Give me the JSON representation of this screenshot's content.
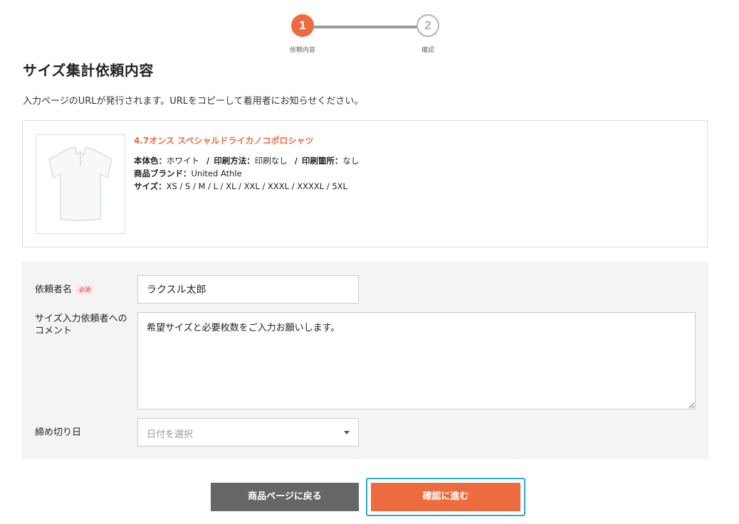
{
  "stepper": {
    "steps": [
      {
        "number": "1",
        "label": "依頼内容"
      },
      {
        "number": "2",
        "label": "確認"
      }
    ],
    "colors": {
      "active": "#ed6c3f",
      "inactive": "#b3b3b3",
      "line": "#9a9a9a"
    }
  },
  "page": {
    "title": "サイズ集計依頼内容",
    "intro": "入力ページのURLが発行されます。URLをコピーして着用者にお知らせください。"
  },
  "product": {
    "image_icon": "polo-shirt-icon",
    "name": "4.7オンス スペシャルドライカノコポロシャツ",
    "body_color_label": "本体色：",
    "body_color_value": "ホワイト",
    "sep1": "/",
    "print_method_label": "印刷方法：",
    "print_method_value": "印刷なし",
    "sep2": "/",
    "print_location_label": "印刷箇所：",
    "print_location_value": "なし",
    "brand_label": "商品ブランド：",
    "brand_value": "United Athle",
    "size_label": "サイズ：",
    "size_value": "XS / S / M / L / XL / XXL / XXXL / XXXXL / 5XL"
  },
  "form": {
    "requester_label": "依頼者名",
    "required_badge": "必須",
    "requester_value": "ラクスル太郎",
    "comment_label_line1": "サイズ入力依頼者への",
    "comment_label_line2": "コメント",
    "comment_value": "希望サイズと必要枚数をご入力お願いします。",
    "deadline_label": "締め切り日",
    "deadline_placeholder": "日付を選択"
  },
  "actions": {
    "back_label": "商品ページに戻る",
    "confirm_label": "確認に進む"
  },
  "colors": {
    "accent": "#ed6c3f",
    "back_button": "#666666",
    "focus_ring": "#27a9d6",
    "required": "#e0313c"
  }
}
